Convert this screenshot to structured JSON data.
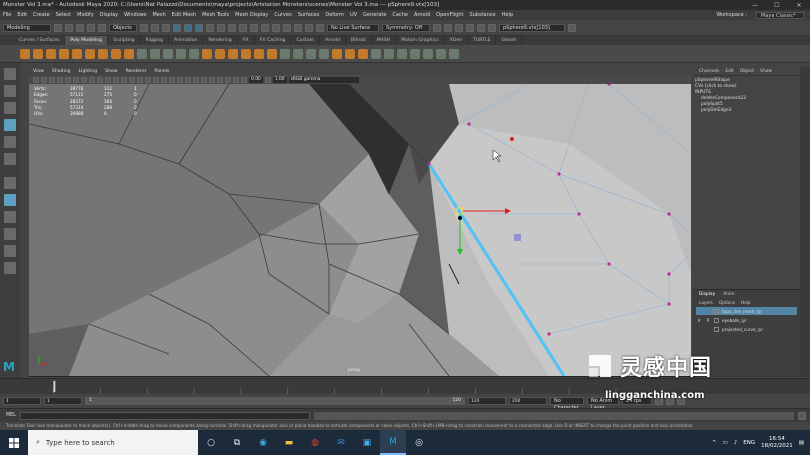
{
  "window": {
    "title": "Monster Vol 3.ma* - Autodesk Maya 2020: C:\\Users\\Nat Palazzo\\Documents\\maya\\projects\\Artstation Monsters\\scenes\\Monster Vol 3.ma  ---  pSphere9.vtx[103]",
    "min": "—",
    "max": "☐",
    "close": "✕"
  },
  "menubar": {
    "items": [
      "File",
      "Edit",
      "Create",
      "Select",
      "Modify",
      "Display",
      "Windows",
      "Mesh",
      "Edit Mesh",
      "Mesh Tools",
      "Mesh Display",
      "Curves",
      "Surfaces",
      "Deform",
      "UV",
      "Generate",
      "Cache",
      "Arnold",
      "OpenFlight",
      "Substance",
      "Help"
    ],
    "workspace_label": "Workspace :",
    "workspace_value": "Maya Classic*"
  },
  "statusline": {
    "mode": "Modeling",
    "objects": "Objects",
    "live_surface": "No Live Surface",
    "symmetry": "Symmetry: Off",
    "selection_field": "pSphere9.vtx[103]"
  },
  "shelf_tabs": [
    "Curves / Surfaces",
    "Poly Modeling",
    "Sculpting",
    "Rigging",
    "Animation",
    "Rendering",
    "FX",
    "FX Caching",
    "Custom",
    "Arnold",
    "Bifrost",
    "MASH",
    "Motion Graphics",
    "XGen",
    "TURTLE",
    "Gleam"
  ],
  "shelf_active": "Poly Modeling",
  "viewport": {
    "menu": [
      "View",
      "Shading",
      "Lighting",
      "Show",
      "Renderer",
      "Panels"
    ],
    "field1": "0.00",
    "field2": "1.00",
    "colorspace": "sRGB gamma",
    "camera_label": "persp",
    "hud_right": "Panel Layout",
    "hud": [
      [
        "Verts:",
        "28776",
        "112",
        "1"
      ],
      [
        "Edges:",
        "57115",
        "275",
        "0"
      ],
      [
        "Faces:",
        "28372",
        "164",
        "0"
      ],
      [
        "Tris:",
        "57314",
        "288",
        "0"
      ],
      [
        "UVs:",
        "30688",
        "0",
        "0"
      ]
    ]
  },
  "channel_box": {
    "tabs": [
      "Channels",
      "Edit",
      "Object",
      "Show"
    ],
    "object": "pSphere9Shape",
    "cvs": "CVs (click to show)",
    "inputs_label": "INPUTS",
    "inputs": [
      "deleteComponent23",
      "polySplit5",
      "polyDelEdge3"
    ]
  },
  "layers": {
    "tabs": [
      "Display",
      "Anim"
    ],
    "menu": [
      "Layers",
      "Options",
      "Help"
    ],
    "rows": [
      {
        "v": "",
        "p": "",
        "name": "topo_live_mesh_lyr",
        "selected": true
      },
      {
        "v": "V",
        "p": "P",
        "name": "eyeballs_lyr",
        "selected": false
      },
      {
        "v": "",
        "p": "",
        "name": "projected_curve_lyr",
        "selected": false
      }
    ]
  },
  "range": {
    "start": "1",
    "start2": "1",
    "slider_left": "1",
    "slider_right": "120",
    "end": "120",
    "end2": "200",
    "char_set": "No Character Set",
    "anim_layer": "No Anim Layer",
    "fps": "24 fps"
  },
  "cmdline": {
    "label": "MEL"
  },
  "helpline": "Translate Tool: Use manipulator to move object(s). Ctrl+middle-drag to move components along normals. Shift+drag manipulator axis or plane handles to extrude components or clone objects. Ctrl+Shift+LMB+drag to constrain movement to a connected edge. Use D or INSERT to change the pivot position and axis orientation.",
  "taskbar": {
    "search_placeholder": "Type here to search",
    "language": "ENG",
    "time": "16:54",
    "date": "18/02/2021"
  },
  "watermark": {
    "cn": "灵感中国",
    "url": "lingganchina.com"
  },
  "colors": {
    "accent": "#5f9fbf",
    "selected_edge": "#4fc3f7",
    "vertex": "#c0289a",
    "maya_blue": "#2aa3c9"
  }
}
